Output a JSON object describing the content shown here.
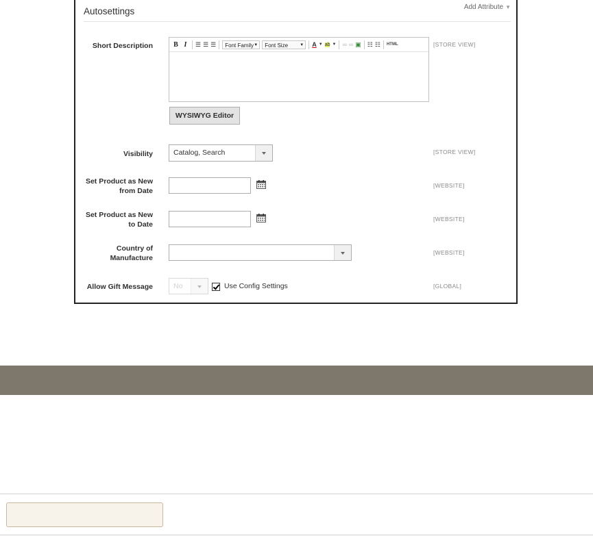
{
  "panel": {
    "title": "Autosettings",
    "add_attribute": "Add Attribute"
  },
  "fields": {
    "short_description": {
      "label": "Short Description",
      "scope": "[STORE VIEW]",
      "toolbar": {
        "bold": "B",
        "italic": "I",
        "font_family": "Font Family",
        "font_size": "Font Size",
        "text_color": "A",
        "highlight": "ab",
        "html": "HTML"
      },
      "value": "",
      "wysiwyg_button": "WYSIWYG Editor"
    },
    "visibility": {
      "label": "Visibility",
      "value": "Catalog, Search",
      "scope": "[STORE VIEW]"
    },
    "new_from": {
      "label_line1": "Set Product as New",
      "label_line2": "from Date",
      "value": "",
      "scope": "[WEBSITE]"
    },
    "new_to": {
      "label_line1": "Set Product as New",
      "label_line2": "to Date",
      "value": "",
      "scope": "[WEBSITE]"
    },
    "country": {
      "label_line1": "Country of",
      "label_line2": "Manufacture",
      "value": "",
      "scope": "[WEBSITE]"
    },
    "gift_message": {
      "label": "Allow Gift Message",
      "value": "No",
      "use_config_label": "Use Config Settings",
      "use_config_checked": true,
      "scope": "[GLOBAL]"
    }
  },
  "colors": {
    "band": "#7d776c",
    "footer_field_bg": "#f7f2ea",
    "footer_field_border": "#c9b89a"
  }
}
